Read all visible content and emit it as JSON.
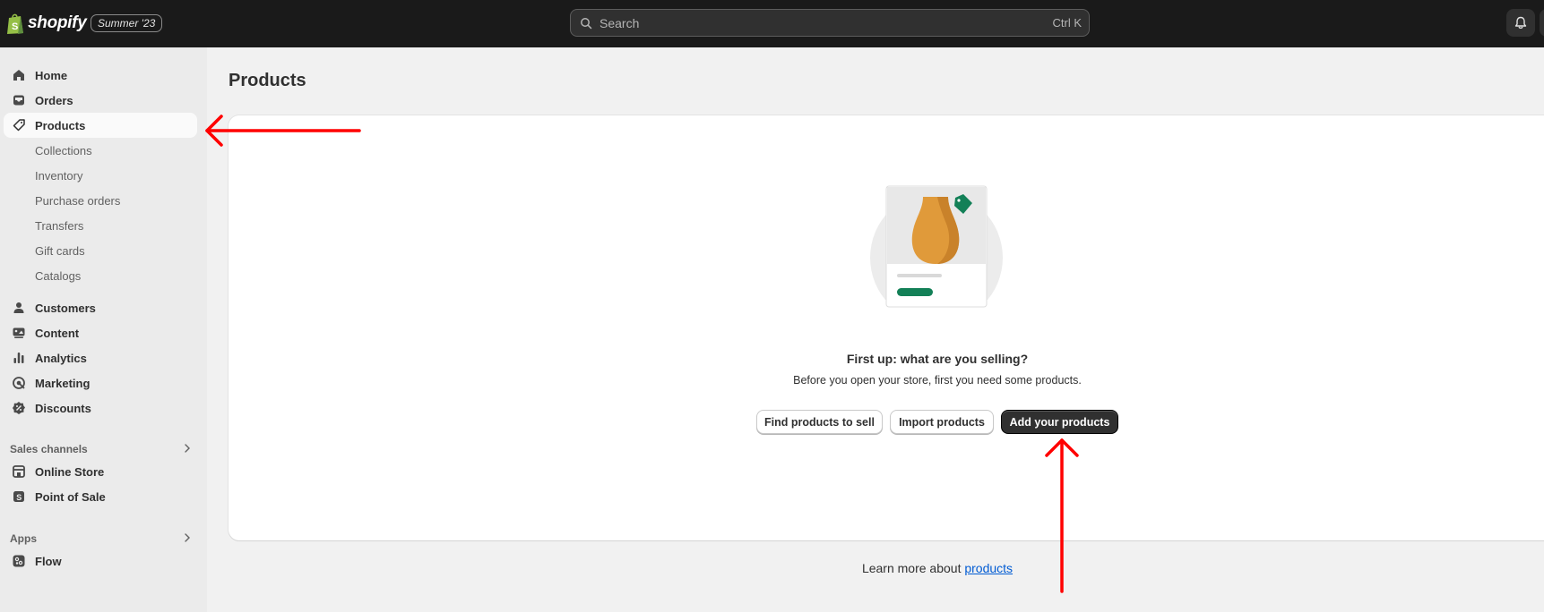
{
  "topbar": {
    "brand": "shopify",
    "edition_badge": "Summer '23",
    "search_placeholder": "Search",
    "search_shortcut": "Ctrl K"
  },
  "sidebar": {
    "main_items": [
      {
        "label": "Home",
        "icon": "home-icon"
      },
      {
        "label": "Orders",
        "icon": "inbox-icon"
      },
      {
        "label": "Products",
        "icon": "tag-icon",
        "active": true
      }
    ],
    "product_subitems": [
      "Collections",
      "Inventory",
      "Purchase orders",
      "Transfers",
      "Gift cards",
      "Catalogs"
    ],
    "secondary_items": [
      {
        "label": "Customers",
        "icon": "person-icon"
      },
      {
        "label": "Content",
        "icon": "content-icon"
      },
      {
        "label": "Analytics",
        "icon": "bar-chart-icon"
      },
      {
        "label": "Marketing",
        "icon": "target-icon"
      },
      {
        "label": "Discounts",
        "icon": "discount-icon"
      }
    ],
    "sales_channels": {
      "label": "Sales channels",
      "items": [
        {
          "label": "Online Store",
          "icon": "store-icon"
        },
        {
          "label": "Point of Sale",
          "icon": "pos-icon"
        }
      ]
    },
    "apps": {
      "label": "Apps",
      "items": [
        {
          "label": "Flow",
          "icon": "flow-icon"
        }
      ]
    }
  },
  "main": {
    "title": "Products",
    "empty_state": {
      "heading": "First up: what are you selling?",
      "description": "Before you open your store, first you need some products.",
      "buttons": {
        "find": "Find products to sell",
        "import": "Import products",
        "add": "Add your products"
      }
    },
    "learn_more": {
      "prefix": "Learn more about ",
      "link": "products"
    }
  },
  "colors": {
    "topbar_bg": "#1a1a1a",
    "sidebar_bg": "#ebebeb",
    "page_bg": "#f1f1f1",
    "primary_button": "#303030",
    "link": "#005bd3",
    "annotation_arrow": "#ff0000"
  }
}
